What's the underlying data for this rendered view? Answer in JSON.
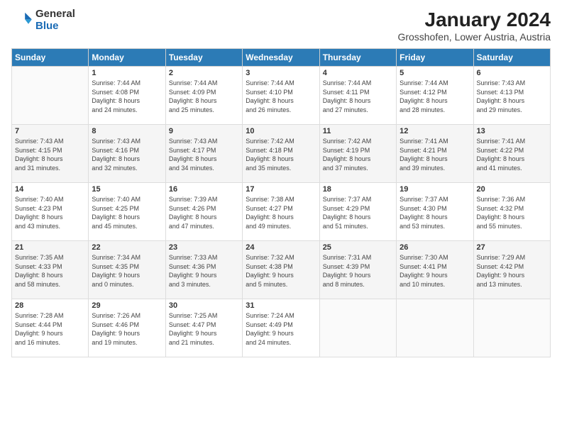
{
  "logo": {
    "general": "General",
    "blue": "Blue"
  },
  "title": "January 2024",
  "subtitle": "Grosshofen, Lower Austria, Austria",
  "weekdays": [
    "Sunday",
    "Monday",
    "Tuesday",
    "Wednesday",
    "Thursday",
    "Friday",
    "Saturday"
  ],
  "weeks": [
    [
      {
        "day": "",
        "content": ""
      },
      {
        "day": "1",
        "content": "Sunrise: 7:44 AM\nSunset: 4:08 PM\nDaylight: 8 hours\nand 24 minutes."
      },
      {
        "day": "2",
        "content": "Sunrise: 7:44 AM\nSunset: 4:09 PM\nDaylight: 8 hours\nand 25 minutes."
      },
      {
        "day": "3",
        "content": "Sunrise: 7:44 AM\nSunset: 4:10 PM\nDaylight: 8 hours\nand 26 minutes."
      },
      {
        "day": "4",
        "content": "Sunrise: 7:44 AM\nSunset: 4:11 PM\nDaylight: 8 hours\nand 27 minutes."
      },
      {
        "day": "5",
        "content": "Sunrise: 7:44 AM\nSunset: 4:12 PM\nDaylight: 8 hours\nand 28 minutes."
      },
      {
        "day": "6",
        "content": "Sunrise: 7:43 AM\nSunset: 4:13 PM\nDaylight: 8 hours\nand 29 minutes."
      }
    ],
    [
      {
        "day": "7",
        "content": "Sunrise: 7:43 AM\nSunset: 4:15 PM\nDaylight: 8 hours\nand 31 minutes."
      },
      {
        "day": "8",
        "content": "Sunrise: 7:43 AM\nSunset: 4:16 PM\nDaylight: 8 hours\nand 32 minutes."
      },
      {
        "day": "9",
        "content": "Sunrise: 7:43 AM\nSunset: 4:17 PM\nDaylight: 8 hours\nand 34 minutes."
      },
      {
        "day": "10",
        "content": "Sunrise: 7:42 AM\nSunset: 4:18 PM\nDaylight: 8 hours\nand 35 minutes."
      },
      {
        "day": "11",
        "content": "Sunrise: 7:42 AM\nSunset: 4:19 PM\nDaylight: 8 hours\nand 37 minutes."
      },
      {
        "day": "12",
        "content": "Sunrise: 7:41 AM\nSunset: 4:21 PM\nDaylight: 8 hours\nand 39 minutes."
      },
      {
        "day": "13",
        "content": "Sunrise: 7:41 AM\nSunset: 4:22 PM\nDaylight: 8 hours\nand 41 minutes."
      }
    ],
    [
      {
        "day": "14",
        "content": "Sunrise: 7:40 AM\nSunset: 4:23 PM\nDaylight: 8 hours\nand 43 minutes."
      },
      {
        "day": "15",
        "content": "Sunrise: 7:40 AM\nSunset: 4:25 PM\nDaylight: 8 hours\nand 45 minutes."
      },
      {
        "day": "16",
        "content": "Sunrise: 7:39 AM\nSunset: 4:26 PM\nDaylight: 8 hours\nand 47 minutes."
      },
      {
        "day": "17",
        "content": "Sunrise: 7:38 AM\nSunset: 4:27 PM\nDaylight: 8 hours\nand 49 minutes."
      },
      {
        "day": "18",
        "content": "Sunrise: 7:37 AM\nSunset: 4:29 PM\nDaylight: 8 hours\nand 51 minutes."
      },
      {
        "day": "19",
        "content": "Sunrise: 7:37 AM\nSunset: 4:30 PM\nDaylight: 8 hours\nand 53 minutes."
      },
      {
        "day": "20",
        "content": "Sunrise: 7:36 AM\nSunset: 4:32 PM\nDaylight: 8 hours\nand 55 minutes."
      }
    ],
    [
      {
        "day": "21",
        "content": "Sunrise: 7:35 AM\nSunset: 4:33 PM\nDaylight: 8 hours\nand 58 minutes."
      },
      {
        "day": "22",
        "content": "Sunrise: 7:34 AM\nSunset: 4:35 PM\nDaylight: 9 hours\nand 0 minutes."
      },
      {
        "day": "23",
        "content": "Sunrise: 7:33 AM\nSunset: 4:36 PM\nDaylight: 9 hours\nand 3 minutes."
      },
      {
        "day": "24",
        "content": "Sunrise: 7:32 AM\nSunset: 4:38 PM\nDaylight: 9 hours\nand 5 minutes."
      },
      {
        "day": "25",
        "content": "Sunrise: 7:31 AM\nSunset: 4:39 PM\nDaylight: 9 hours\nand 8 minutes."
      },
      {
        "day": "26",
        "content": "Sunrise: 7:30 AM\nSunset: 4:41 PM\nDaylight: 9 hours\nand 10 minutes."
      },
      {
        "day": "27",
        "content": "Sunrise: 7:29 AM\nSunset: 4:42 PM\nDaylight: 9 hours\nand 13 minutes."
      }
    ],
    [
      {
        "day": "28",
        "content": "Sunrise: 7:28 AM\nSunset: 4:44 PM\nDaylight: 9 hours\nand 16 minutes."
      },
      {
        "day": "29",
        "content": "Sunrise: 7:26 AM\nSunset: 4:46 PM\nDaylight: 9 hours\nand 19 minutes."
      },
      {
        "day": "30",
        "content": "Sunrise: 7:25 AM\nSunset: 4:47 PM\nDaylight: 9 hours\nand 21 minutes."
      },
      {
        "day": "31",
        "content": "Sunrise: 7:24 AM\nSunset: 4:49 PM\nDaylight: 9 hours\nand 24 minutes."
      },
      {
        "day": "",
        "content": ""
      },
      {
        "day": "",
        "content": ""
      },
      {
        "day": "",
        "content": ""
      }
    ]
  ]
}
